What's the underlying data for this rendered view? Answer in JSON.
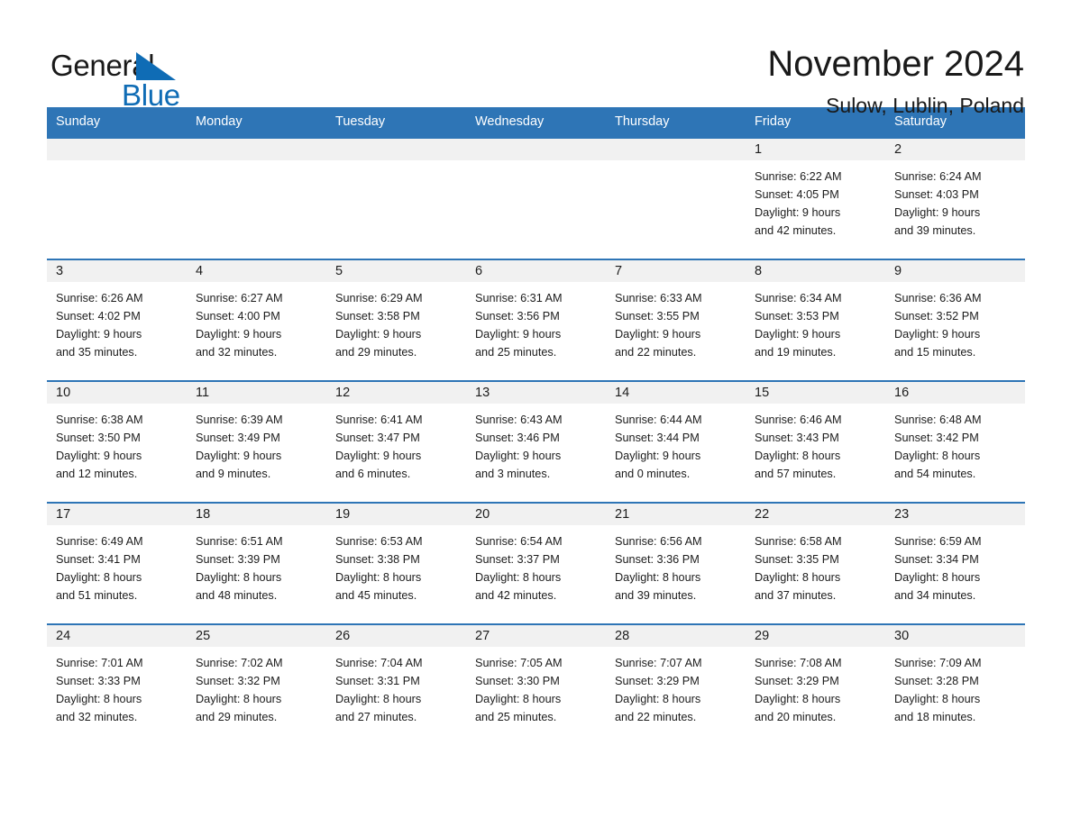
{
  "brand": {
    "name_part1": "General",
    "name_part2": "Blue",
    "triangle_color": "#0f6cb5",
    "accent_color": "#2e75b6"
  },
  "header": {
    "month_title": "November 2024",
    "location": "Sulow, Lublin, Poland"
  },
  "weekday_headers": [
    "Sunday",
    "Monday",
    "Tuesday",
    "Wednesday",
    "Thursday",
    "Friday",
    "Saturday"
  ],
  "weeks": [
    [
      {
        "day": "",
        "sunrise": "",
        "sunset": "",
        "daylight_line1": "",
        "daylight_line2": "",
        "empty": true
      },
      {
        "day": "",
        "sunrise": "",
        "sunset": "",
        "daylight_line1": "",
        "daylight_line2": "",
        "empty": true
      },
      {
        "day": "",
        "sunrise": "",
        "sunset": "",
        "daylight_line1": "",
        "daylight_line2": "",
        "empty": true
      },
      {
        "day": "",
        "sunrise": "",
        "sunset": "",
        "daylight_line1": "",
        "daylight_line2": "",
        "empty": true
      },
      {
        "day": "",
        "sunrise": "",
        "sunset": "",
        "daylight_line1": "",
        "daylight_line2": "",
        "empty": true
      },
      {
        "day": "1",
        "sunrise": "Sunrise: 6:22 AM",
        "sunset": "Sunset: 4:05 PM",
        "daylight_line1": "Daylight: 9 hours",
        "daylight_line2": "and 42 minutes."
      },
      {
        "day": "2",
        "sunrise": "Sunrise: 6:24 AM",
        "sunset": "Sunset: 4:03 PM",
        "daylight_line1": "Daylight: 9 hours",
        "daylight_line2": "and 39 minutes."
      }
    ],
    [
      {
        "day": "3",
        "sunrise": "Sunrise: 6:26 AM",
        "sunset": "Sunset: 4:02 PM",
        "daylight_line1": "Daylight: 9 hours",
        "daylight_line2": "and 35 minutes."
      },
      {
        "day": "4",
        "sunrise": "Sunrise: 6:27 AM",
        "sunset": "Sunset: 4:00 PM",
        "daylight_line1": "Daylight: 9 hours",
        "daylight_line2": "and 32 minutes."
      },
      {
        "day": "5",
        "sunrise": "Sunrise: 6:29 AM",
        "sunset": "Sunset: 3:58 PM",
        "daylight_line1": "Daylight: 9 hours",
        "daylight_line2": "and 29 minutes."
      },
      {
        "day": "6",
        "sunrise": "Sunrise: 6:31 AM",
        "sunset": "Sunset: 3:56 PM",
        "daylight_line1": "Daylight: 9 hours",
        "daylight_line2": "and 25 minutes."
      },
      {
        "day": "7",
        "sunrise": "Sunrise: 6:33 AM",
        "sunset": "Sunset: 3:55 PM",
        "daylight_line1": "Daylight: 9 hours",
        "daylight_line2": "and 22 minutes."
      },
      {
        "day": "8",
        "sunrise": "Sunrise: 6:34 AM",
        "sunset": "Sunset: 3:53 PM",
        "daylight_line1": "Daylight: 9 hours",
        "daylight_line2": "and 19 minutes."
      },
      {
        "day": "9",
        "sunrise": "Sunrise: 6:36 AM",
        "sunset": "Sunset: 3:52 PM",
        "daylight_line1": "Daylight: 9 hours",
        "daylight_line2": "and 15 minutes."
      }
    ],
    [
      {
        "day": "10",
        "sunrise": "Sunrise: 6:38 AM",
        "sunset": "Sunset: 3:50 PM",
        "daylight_line1": "Daylight: 9 hours",
        "daylight_line2": "and 12 minutes."
      },
      {
        "day": "11",
        "sunrise": "Sunrise: 6:39 AM",
        "sunset": "Sunset: 3:49 PM",
        "daylight_line1": "Daylight: 9 hours",
        "daylight_line2": "and 9 minutes."
      },
      {
        "day": "12",
        "sunrise": "Sunrise: 6:41 AM",
        "sunset": "Sunset: 3:47 PM",
        "daylight_line1": "Daylight: 9 hours",
        "daylight_line2": "and 6 minutes."
      },
      {
        "day": "13",
        "sunrise": "Sunrise: 6:43 AM",
        "sunset": "Sunset: 3:46 PM",
        "daylight_line1": "Daylight: 9 hours",
        "daylight_line2": "and 3 minutes."
      },
      {
        "day": "14",
        "sunrise": "Sunrise: 6:44 AM",
        "sunset": "Sunset: 3:44 PM",
        "daylight_line1": "Daylight: 9 hours",
        "daylight_line2": "and 0 minutes."
      },
      {
        "day": "15",
        "sunrise": "Sunrise: 6:46 AM",
        "sunset": "Sunset: 3:43 PM",
        "daylight_line1": "Daylight: 8 hours",
        "daylight_line2": "and 57 minutes."
      },
      {
        "day": "16",
        "sunrise": "Sunrise: 6:48 AM",
        "sunset": "Sunset: 3:42 PM",
        "daylight_line1": "Daylight: 8 hours",
        "daylight_line2": "and 54 minutes."
      }
    ],
    [
      {
        "day": "17",
        "sunrise": "Sunrise: 6:49 AM",
        "sunset": "Sunset: 3:41 PM",
        "daylight_line1": "Daylight: 8 hours",
        "daylight_line2": "and 51 minutes."
      },
      {
        "day": "18",
        "sunrise": "Sunrise: 6:51 AM",
        "sunset": "Sunset: 3:39 PM",
        "daylight_line1": "Daylight: 8 hours",
        "daylight_line2": "and 48 minutes."
      },
      {
        "day": "19",
        "sunrise": "Sunrise: 6:53 AM",
        "sunset": "Sunset: 3:38 PM",
        "daylight_line1": "Daylight: 8 hours",
        "daylight_line2": "and 45 minutes."
      },
      {
        "day": "20",
        "sunrise": "Sunrise: 6:54 AM",
        "sunset": "Sunset: 3:37 PM",
        "daylight_line1": "Daylight: 8 hours",
        "daylight_line2": "and 42 minutes."
      },
      {
        "day": "21",
        "sunrise": "Sunrise: 6:56 AM",
        "sunset": "Sunset: 3:36 PM",
        "daylight_line1": "Daylight: 8 hours",
        "daylight_line2": "and 39 minutes."
      },
      {
        "day": "22",
        "sunrise": "Sunrise: 6:58 AM",
        "sunset": "Sunset: 3:35 PM",
        "daylight_line1": "Daylight: 8 hours",
        "daylight_line2": "and 37 minutes."
      },
      {
        "day": "23",
        "sunrise": "Sunrise: 6:59 AM",
        "sunset": "Sunset: 3:34 PM",
        "daylight_line1": "Daylight: 8 hours",
        "daylight_line2": "and 34 minutes."
      }
    ],
    [
      {
        "day": "24",
        "sunrise": "Sunrise: 7:01 AM",
        "sunset": "Sunset: 3:33 PM",
        "daylight_line1": "Daylight: 8 hours",
        "daylight_line2": "and 32 minutes."
      },
      {
        "day": "25",
        "sunrise": "Sunrise: 7:02 AM",
        "sunset": "Sunset: 3:32 PM",
        "daylight_line1": "Daylight: 8 hours",
        "daylight_line2": "and 29 minutes."
      },
      {
        "day": "26",
        "sunrise": "Sunrise: 7:04 AM",
        "sunset": "Sunset: 3:31 PM",
        "daylight_line1": "Daylight: 8 hours",
        "daylight_line2": "and 27 minutes."
      },
      {
        "day": "27",
        "sunrise": "Sunrise: 7:05 AM",
        "sunset": "Sunset: 3:30 PM",
        "daylight_line1": "Daylight: 8 hours",
        "daylight_line2": "and 25 minutes."
      },
      {
        "day": "28",
        "sunrise": "Sunrise: 7:07 AM",
        "sunset": "Sunset: 3:29 PM",
        "daylight_line1": "Daylight: 8 hours",
        "daylight_line2": "and 22 minutes."
      },
      {
        "day": "29",
        "sunrise": "Sunrise: 7:08 AM",
        "sunset": "Sunset: 3:29 PM",
        "daylight_line1": "Daylight: 8 hours",
        "daylight_line2": "and 20 minutes."
      },
      {
        "day": "30",
        "sunrise": "Sunrise: 7:09 AM",
        "sunset": "Sunset: 3:28 PM",
        "daylight_line1": "Daylight: 8 hours",
        "daylight_line2": "and 18 minutes."
      }
    ]
  ]
}
